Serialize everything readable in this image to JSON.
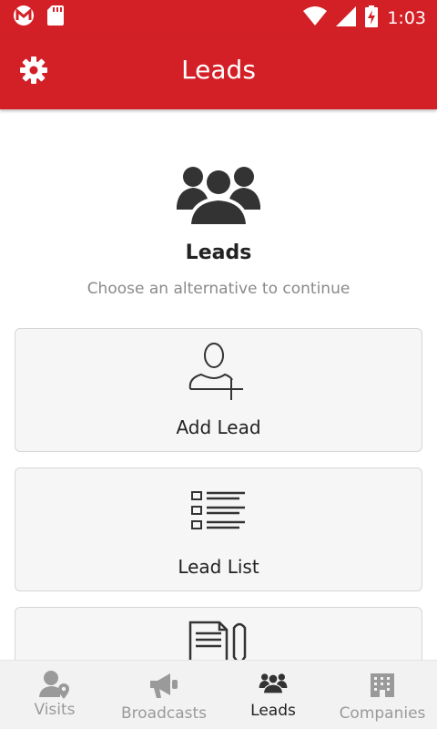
{
  "status_bar": {
    "time": "1:03",
    "icons": [
      "gmail-icon",
      "sd-card-icon",
      "wifi-icon",
      "signal-icon",
      "battery-charging-icon"
    ]
  },
  "app_bar": {
    "title": "Leads",
    "settings_icon": "gear-icon"
  },
  "hero": {
    "icon": "group-icon",
    "title": "Leads",
    "subtitle": "Choose an alternative to continue"
  },
  "cards": [
    {
      "label": "Add Lead",
      "icon": "add-user-icon"
    },
    {
      "label": "Lead List",
      "icon": "list-icon"
    },
    {
      "label": "",
      "icon": "document-pen-icon"
    }
  ],
  "bottom_nav": {
    "items": [
      {
        "label": "Visits",
        "icon": "person-location-icon",
        "active": false
      },
      {
        "label": "Broadcasts",
        "icon": "megaphone-icon",
        "active": false
      },
      {
        "label": "Leads",
        "icon": "group-icon",
        "active": true
      },
      {
        "label": "Companies",
        "icon": "building-icon",
        "active": false
      }
    ]
  },
  "colors": {
    "brand_red": "#d32027",
    "nav_inactive": "#9a9a9a",
    "nav_active": "#222222",
    "card_bg": "#f6f6f6",
    "card_border": "#d6d6d6"
  }
}
